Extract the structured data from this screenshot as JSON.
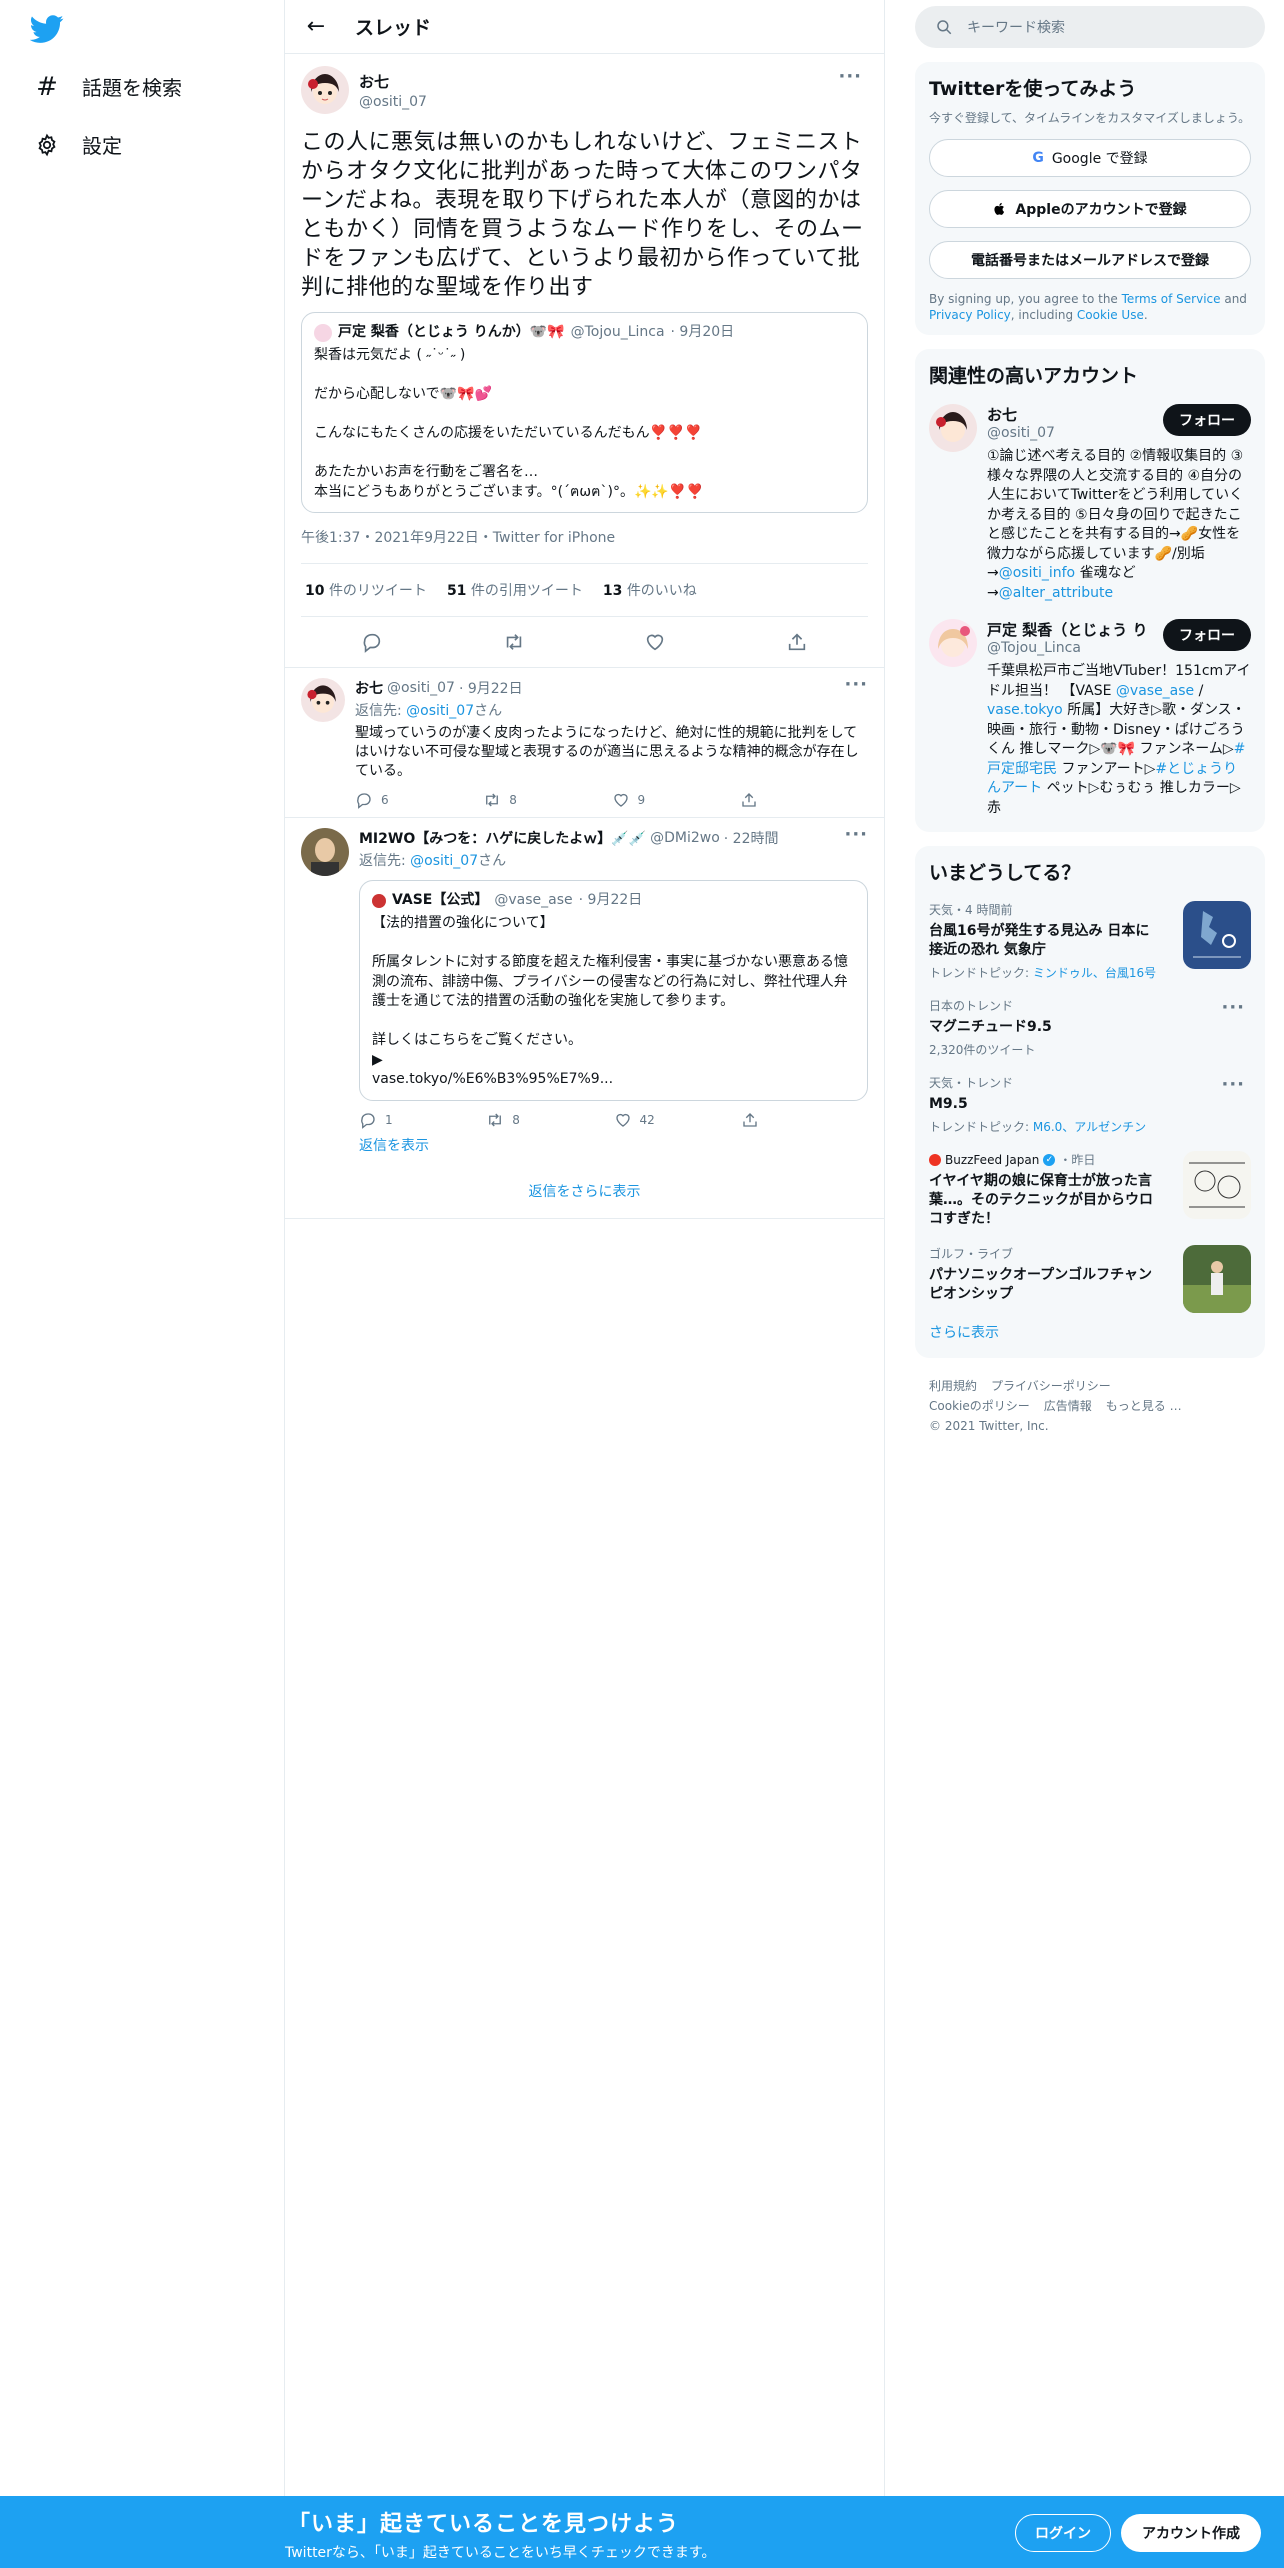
{
  "nav": {
    "explore_label": "話題を検索",
    "settings_label": "設定"
  },
  "header": {
    "title": "スレッド"
  },
  "main_tweet": {
    "name": "お七",
    "handle": "@ositi_07",
    "text": "この人に悪気は無いのかもしれないけど、フェミニストからオタク文化に批判があった時って大体このワンパターンだよね。表現を取り下げられた本人が（意図的かはともかく）同情を買うようなムード作りをし、そのムードをファンも広げて、というより最初から作っていて批判に排他的な聖域を作り出す",
    "quote": {
      "name": "戸定 梨香（とじょう りんか）🐨🎀",
      "handle": "@Tojou_Linca",
      "date": "· 9月20日",
      "text": "梨香は元気だよ ( ˶˙ᵕ˙˶ )\n\nだから心配しないで🐨🎀💕\n\nこんなにもたくさんの応援をいただいているんだもん❣️❣️❣️\n\nあたたかいお声を行動をご署名を…\n本当にどうもありがとうございます。°(´ฅωฅ`)°。✨✨❣️❣️"
    },
    "meta": "午後1:37・2021年9月22日・Twitter for iPhone",
    "retweets_count": "10",
    "retweets_label": "件のリツイート",
    "quotes_count": "51",
    "quotes_label": "件の引用ツイート",
    "likes_count": "13",
    "likes_label": "件のいいね"
  },
  "replies": [
    {
      "name": "お七",
      "handle": "@ositi_07",
      "date": "· 9月22日",
      "reply_to_prefix": "返信先: ",
      "reply_to_handle": "@ositi_07",
      "reply_to_suffix": "さん",
      "text": "聖域っていうのが凄く皮肉ったようになったけど、絶対に性的規範に批判をしてはいけない不可侵な聖域と表現するのが適当に思えるような精神的概念が存在している。",
      "replies": "6",
      "retweets": "8",
      "likes": "9"
    },
    {
      "name": "MI2WO【みつを：ハゲに戻したよｗ】💉💉",
      "handle": "@DMi2wo",
      "date": "· 22時間",
      "reply_to_prefix": "返信先: ",
      "reply_to_handle": "@ositi_07",
      "reply_to_suffix": "さん",
      "quote": {
        "name": "VASE【公式】",
        "handle": "@vase_ase",
        "date": "· 9月22日",
        "text": "【法的措置の強化について】\n\n所属タレントに対する節度を超えた権利侵害・事実に基づかない悪意ある憶測の流布、誹謗中傷、プライバシーの侵害などの行為に対し、弊社代理人弁護士を通じて法的措置の活動の強化を実施して参ります。\n\n詳しくはこちらをご覧ください。\n▶︎\nvase.tokyo/%E6%B3%95%E7%9..."
      },
      "replies": "1",
      "retweets": "8",
      "likes": "42",
      "show_replies": "返信を表示"
    }
  ],
  "more_replies": "返信をさらに表示",
  "right": {
    "search_placeholder": "キーワード検索",
    "signup_card": {
      "title": "Twitterを使ってみよう",
      "subtitle": "今すぐ登録して、タイムラインをカスタマイズしましょう。",
      "google_label": "Google で登録",
      "apple_label": "Appleのアカウントで登録",
      "phone_label": "電話番号またはメールアドレスで登録",
      "terms_prefix": "By signing up, you agree to the ",
      "terms_link": "Terms of Service",
      "terms_and": " and ",
      "privacy_link": "Privacy Policy",
      "including": ", including ",
      "cookie_link": "Cookie Use",
      "end": "."
    },
    "related": {
      "title": "関連性の高いアカウント",
      "follow_label": "フォロー",
      "accounts": [
        {
          "name": "お七",
          "handle": "@ositi_07",
          "bio_1": "①論じ述べ考える目的 ②情報収集目的 ③様々な界隈の人と交流する目的 ④自分の人生においてTwitterをどう利用していくか考える目的 ⑤日々身の回りで起きたこと感じたことを共有する目的→🥜女性を微力ながら応援しています🥜/別垢→",
          "bio_link1": "@ositi_info",
          "bio_2": " 雀魂など→",
          "bio_link2": "@alter_attribute"
        },
        {
          "name": "戸定 梨香（とじょう り",
          "handle": "@Tojou_Linca",
          "bio_1": "千葉県松戸市ご当地VTuber！151cmアイドル担当！ 【VASE ",
          "bio_link1": "@vase_ase",
          "bio_2": " / ",
          "bio_link2": "vase.tokyo",
          "bio_3": " 所属】大好き▷歌・ダンス・映画・旅行・動物・Disney・ぱけごろうくん 推しマーク▷🐨🎀 ファンネーム▷",
          "bio_link3": "#戸定邸宅民",
          "bio_4": " ファンアート▷",
          "bio_link4": "#とじょうりんアート",
          "bio_5": " ペット▷むぅむぅ 推しカラー▷赤"
        }
      ]
    },
    "trends": {
      "title": "いまどうしてる？",
      "items": [
        {
          "context": "天気・4 時間前",
          "title": "台風16号が発生する見込み 日本に接近の恐れ 気象庁",
          "topics_prefix": "トレンドトピック: ",
          "topics": "ミンドゥル、台風16号"
        },
        {
          "context": "日本のトレンド",
          "title": "マグニチュード9.5",
          "count": "2,320件のツイート"
        },
        {
          "context": "天気・トレンド",
          "title": "M9.5",
          "topics_prefix": "トレンドトピック: ",
          "topics": "M6.0、アルゼンチン"
        },
        {
          "context_source": "BuzzFeed Japan",
          "context_time": "・昨日",
          "title": "イヤイヤ期の娘に保育士が放った言葉…。そのテクニックが目からウロコすぎた！"
        },
        {
          "context": "ゴルフ・ライブ",
          "title": "パナソニックオープンゴルフチャンピオンシップ"
        }
      ],
      "show_more": "さらに表示"
    },
    "footer": {
      "terms": "利用規約",
      "privacy": "プライバシーポリシー",
      "cookie": "Cookieのポリシー",
      "ads": "広告情報",
      "more": "もっと見る …",
      "copyright": "© 2021 Twitter, Inc."
    }
  },
  "bottom_bar": {
    "title": "「いま」起きていることを見つけよう",
    "subtitle": "Twitterなら、「いま」起きていることをいち早くチェックできます。",
    "login": "ログイン",
    "signup": "アカウント作成"
  },
  "colors": {
    "accent": "#1da1f2",
    "link": "#1b95e0",
    "text": "#0f1419",
    "muted": "#657786"
  }
}
